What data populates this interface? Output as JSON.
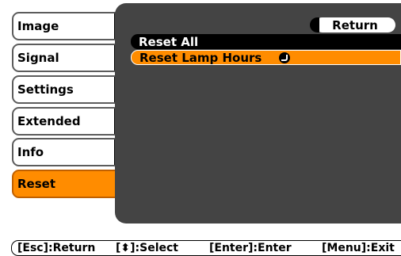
{
  "sidebar": {
    "items": [
      {
        "label": "Image"
      },
      {
        "label": "Signal"
      },
      {
        "label": "Settings"
      },
      {
        "label": "Extended"
      },
      {
        "label": "Info"
      },
      {
        "label": "Reset",
        "active": true
      }
    ]
  },
  "panel": {
    "return_label": "Return",
    "rows": [
      {
        "label": "Reset All"
      },
      {
        "label": "Reset Lamp Hours",
        "selected": true,
        "icon": "enter-icon"
      }
    ]
  },
  "footer": {
    "esc_hint": "[Esc]:Return",
    "select_hint": "[⬍]:Select",
    "enter_hint": "[Enter]:Enter",
    "menu_hint": "[Menu]:Exit"
  },
  "colors": {
    "accent": "#ff8c00",
    "panel": "#444444",
    "tab_bg": "#ffffff"
  }
}
